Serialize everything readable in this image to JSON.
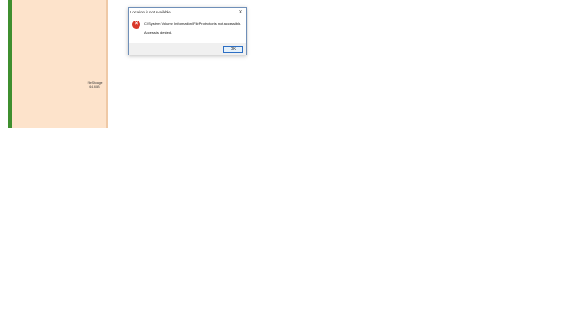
{
  "desktop": {
    "tile_label_line1": "FileStorage",
    "tile_label_line2": "64.6GB"
  },
  "dialog": {
    "title": "Location is not available",
    "close_glyph": "✕",
    "icon": "error-icon",
    "message": "C:\\System Volume Information\\FileProtector is not accessible.",
    "detail": "Access is denied.",
    "ok_label": "OK"
  },
  "colors": {
    "panel": "#fde3cb",
    "strip": "#3f8f2f",
    "error": "#d9382a",
    "button_border": "#2d6fc4"
  }
}
